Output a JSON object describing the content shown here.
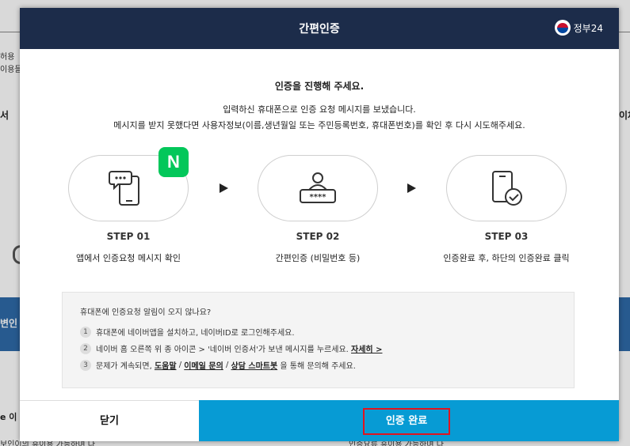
{
  "background": {
    "left_lines": [
      "허용",
      "이용들"
    ],
    "tab_left": "서",
    "tab_right": "이체",
    "band_text": "변인",
    "bottom_text": "e 이",
    "foot_left": "보인이의 휴이용 가능하며 다",
    "foot_right": "인증요류 휴이용 가능하며 다"
  },
  "modal": {
    "title": "간편인증",
    "gov_logo_text": "정부24",
    "headline": "인증을 진행해 주세요.",
    "desc_line1": "입력하신 휴대폰으로 인증 요청 메시지를 보냈습니다.",
    "desc_line2": "메시지를 받지 못했다면 사용자정보(이름,생년월일 또는 주민등록번호, 휴대폰번호)를 확인 후 다시 시도해주세요.",
    "naver_badge": "N",
    "steps": [
      {
        "num": "STEP 01",
        "desc": "앱에서 인증요청 메시지 확인",
        "icon": "phone-message-icon"
      },
      {
        "num": "STEP 02",
        "desc": "간편인증 (비밀번호 등)",
        "icon": "user-password-icon"
      },
      {
        "num": "STEP 03",
        "desc": "인증완료 후, 하단의 인증완료 클릭",
        "icon": "phone-check-icon"
      }
    ],
    "notice": {
      "question": "휴대폰에 인증요청 알림이 오지 않나요?",
      "item1": {
        "n": "1",
        "text": "휴대폰에 네이버앱을 설치하고, 네이버ID로 로그인해주세요."
      },
      "item2": {
        "n": "2",
        "text": "네이버 홈 오른쪽 위 종 아이콘 > '네이버 인증서'가 보낸 메시지를 누르세요.",
        "link": "자세히 >"
      },
      "item3": {
        "n": "3",
        "prefix": "문제가 계속되면, ",
        "link1": "도움말",
        "sep1": " / ",
        "link2": "이메일 문의",
        "sep2": " / ",
        "link3": "상담 스마트봇",
        "suffix": " 을 통해 문의해 주세요."
      }
    },
    "close_label": "닫기",
    "done_label": "인증 완료"
  },
  "colors": {
    "header": "#1c2c4a",
    "done_button": "#079bd4",
    "highlight": "#e1141e",
    "naver": "#03c75a"
  }
}
